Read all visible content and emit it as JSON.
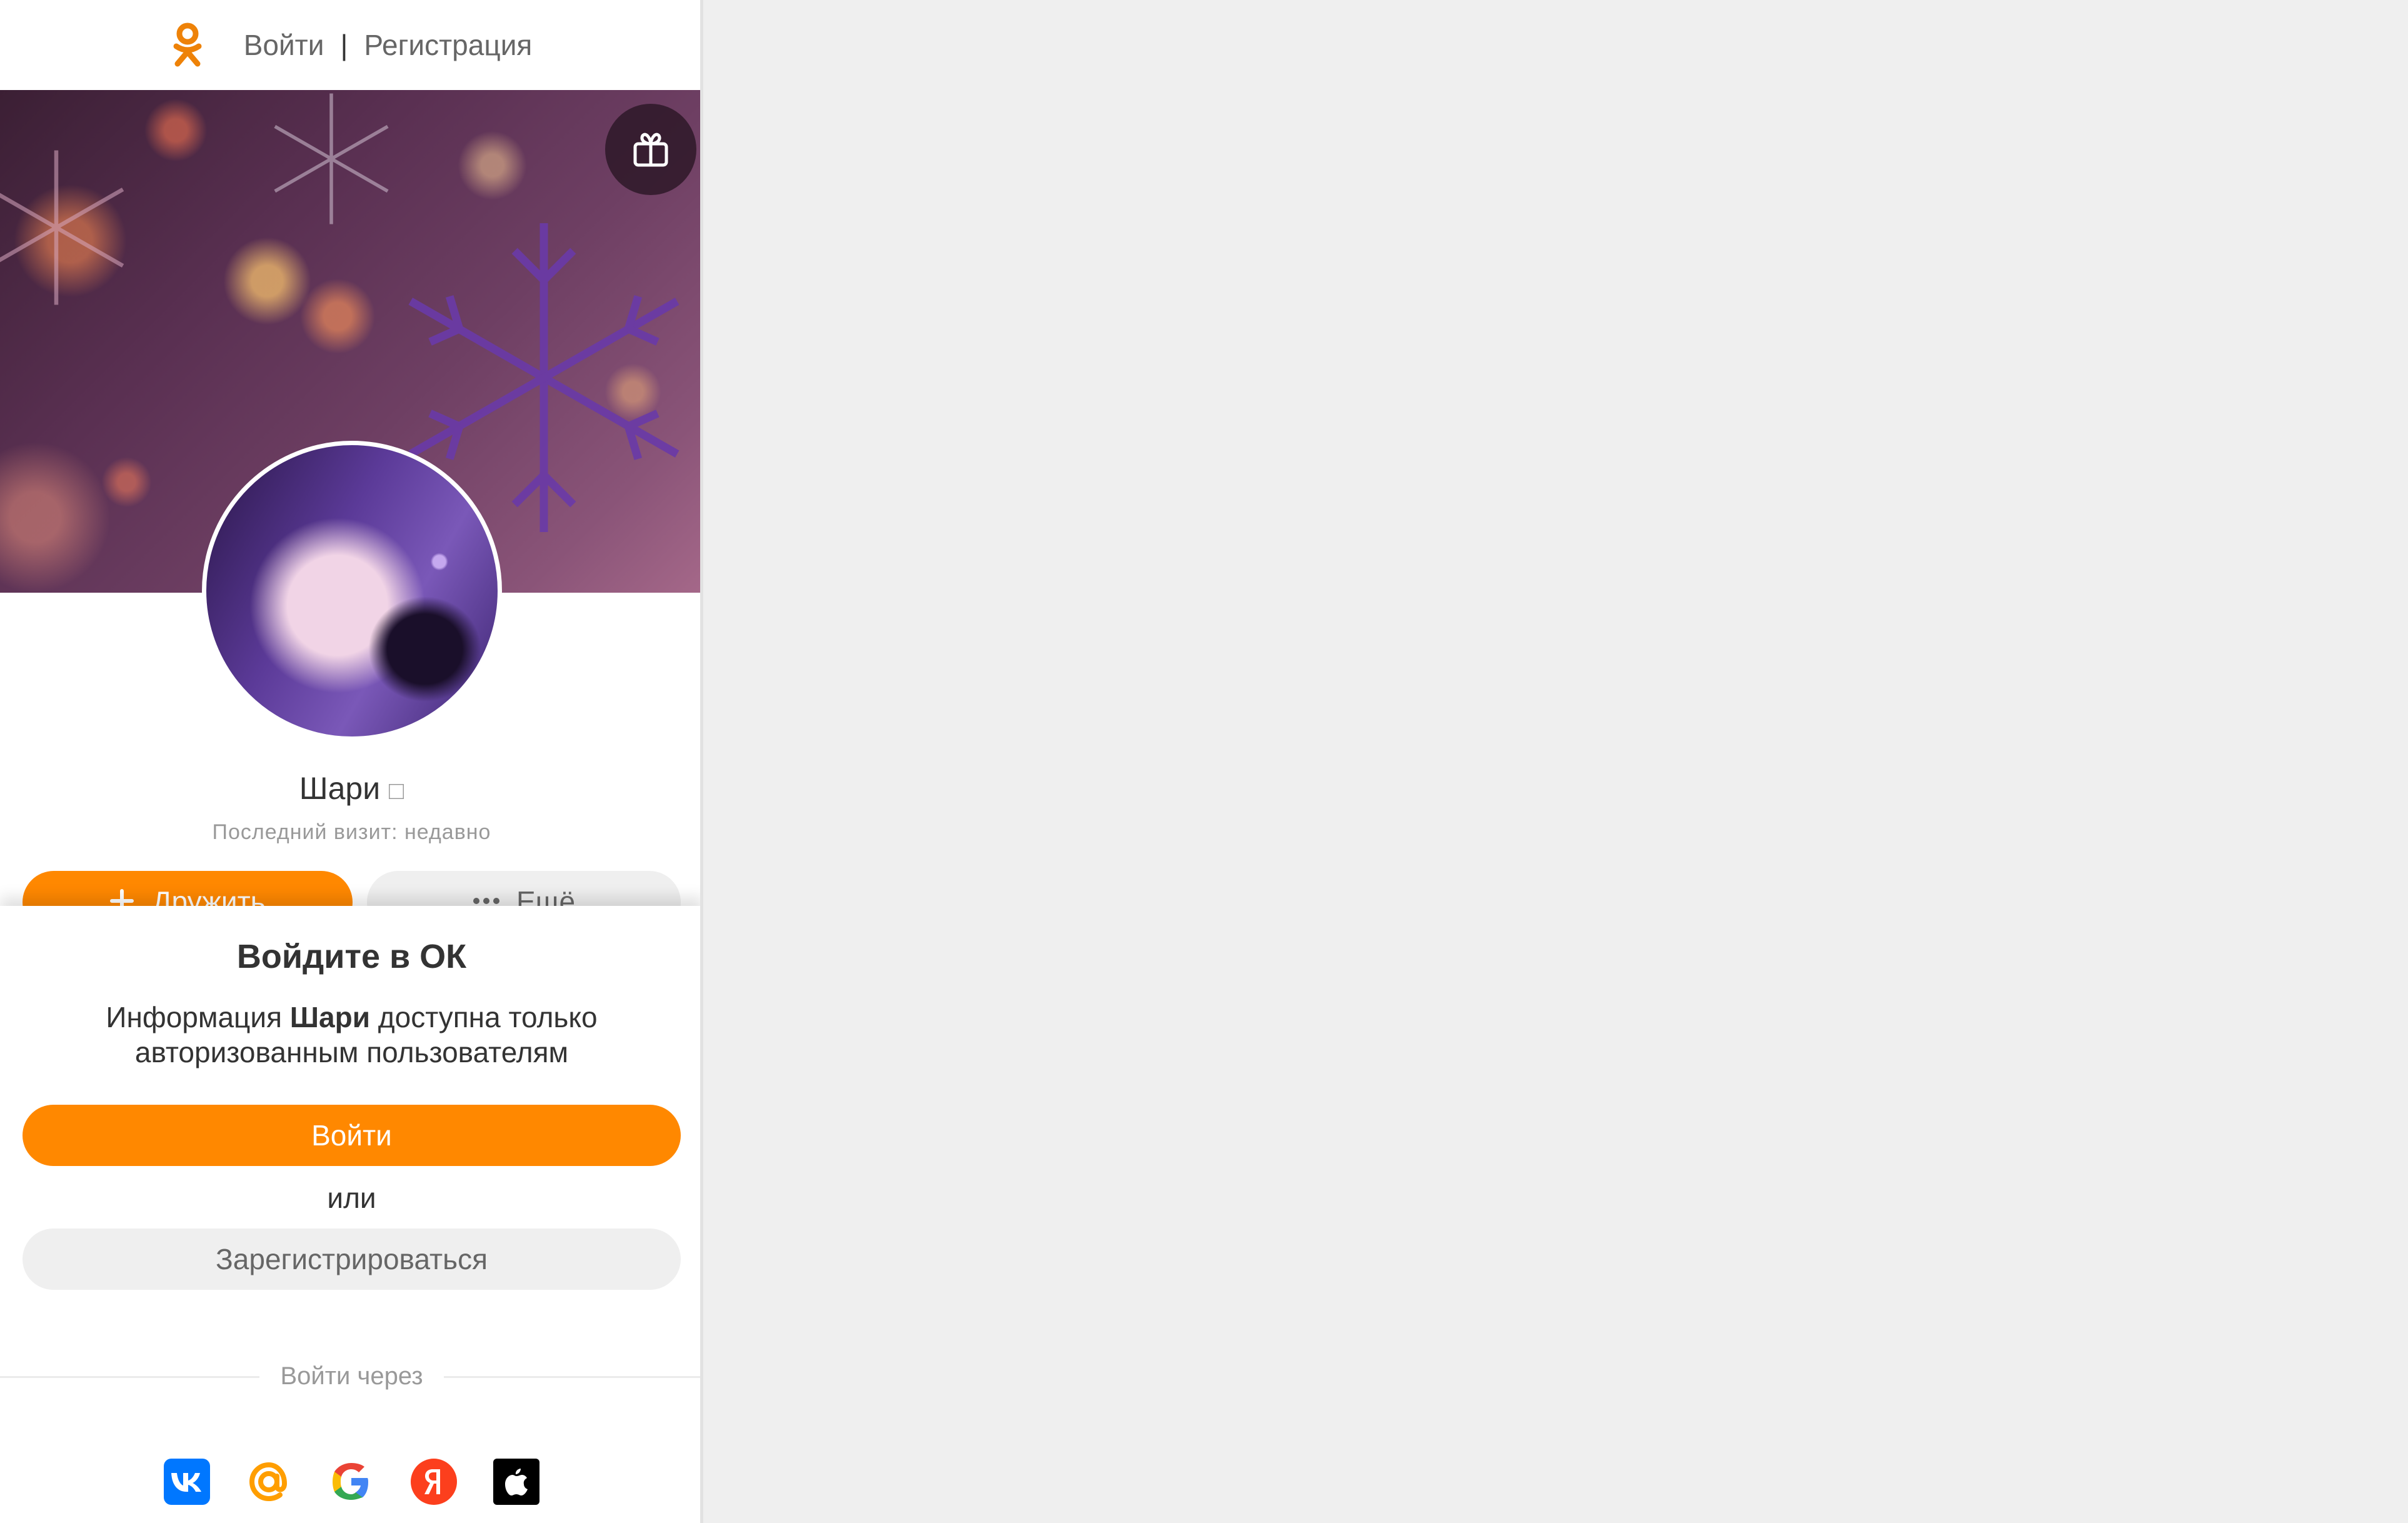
{
  "header": {
    "login_link": "Войти",
    "separator": "|",
    "register_link": "Регистрация"
  },
  "profile": {
    "name": "Шари",
    "name_suffix_glyph": "□",
    "last_visit": "Последний визит: недавно",
    "friends_button": "Дружить",
    "more_button": "Ещё"
  },
  "login_sheet": {
    "title": "Войдите в ОК",
    "desc_before": "Информация",
    "desc_name": "Шари",
    "desc_after": "доступна только авторизованным пользователям",
    "login_button": "Войти",
    "or_text": "или",
    "register_button": "Зарегистрироваться",
    "login_via": "Войти через"
  },
  "social_icons": [
    "vk-icon",
    "mail-ru-icon",
    "google-icon",
    "yandex-icon",
    "apple-icon"
  ],
  "colors": {
    "accent": "#ff8800",
    "text": "#333333",
    "muted": "#999999",
    "vk": "#0077ff",
    "mail": "#ff9e00",
    "yandex": "#fc3f1d",
    "apple": "#000000"
  }
}
